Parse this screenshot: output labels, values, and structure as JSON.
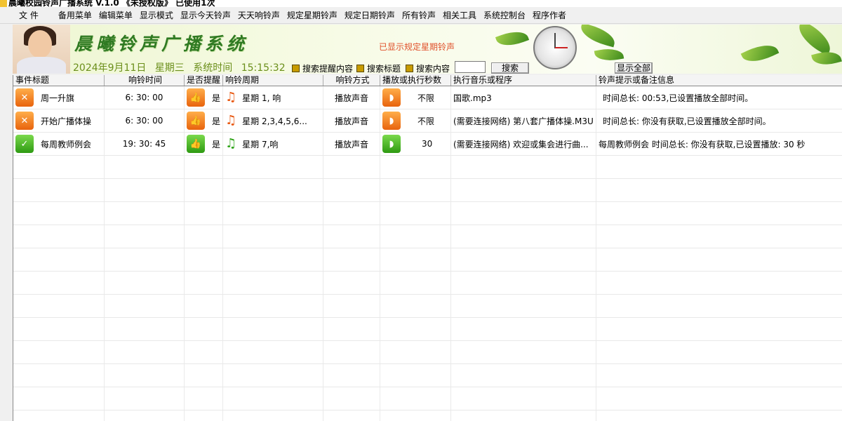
{
  "window": {
    "title": "晨曦校园铃声广播系统 V.1.0 《未授权版》 已使用1次"
  },
  "menu": [
    "文 件",
    "备用菜单",
    "编辑菜单",
    "显示模式",
    "显示今天铃声",
    "天天响铃声",
    "规定星期铃声",
    "规定日期铃声",
    "所有铃声",
    "相关工具",
    "系统控制台",
    "程序作者"
  ],
  "banner": {
    "app_title": "晨曦铃声广播系统",
    "status_notice": "已显示规定星期铃声",
    "date": "2024年9月11日",
    "weekday": "星期三",
    "time_label": "系统时间",
    "time": "15:15:32"
  },
  "search": {
    "options": [
      "搜索提醒内容",
      "搜索标题",
      "搜索内容"
    ],
    "input_value": "",
    "search_button": "搜索",
    "show_all_button": "显示全部"
  },
  "table": {
    "columns": [
      "事件标题",
      "响铃时间",
      "是否提醒",
      "响铃周期",
      "响铃方式",
      "播放或执行秒数",
      "执行音乐或程序",
      "铃声提示或备注信息"
    ],
    "rows": [
      {
        "status": "orange",
        "title": "周一升旗",
        "time": "6: 30: 00",
        "remind": "是",
        "cycle": "星期 1, 响",
        "mode": "播放声音",
        "seconds": "不限",
        "program": "国歌.mp3",
        "note": "时间总长:  00:53,已设置播放全部时间。"
      },
      {
        "status": "orange",
        "title": "开始广播体操",
        "time": "6: 30: 00",
        "remind": "是",
        "cycle": "星期 2,3,4,5,6...",
        "mode": "播放声音",
        "seconds": "不限",
        "program": "(需要连接网络) 第八套广播体操.M3U",
        "note": "时间总长:  你没有获取,已设置播放全部时间。"
      },
      {
        "status": "green",
        "title": "每周教师例会",
        "time": "19: 30: 45",
        "remind": "是",
        "cycle": "星期 7,响",
        "mode": "播放声音",
        "seconds": "30",
        "program": "(需要连接网络) 欢迎或集会进行曲...",
        "note": "每周教师例会 时间总长:  你没有获取,已设置播放: 30 秒"
      }
    ]
  }
}
